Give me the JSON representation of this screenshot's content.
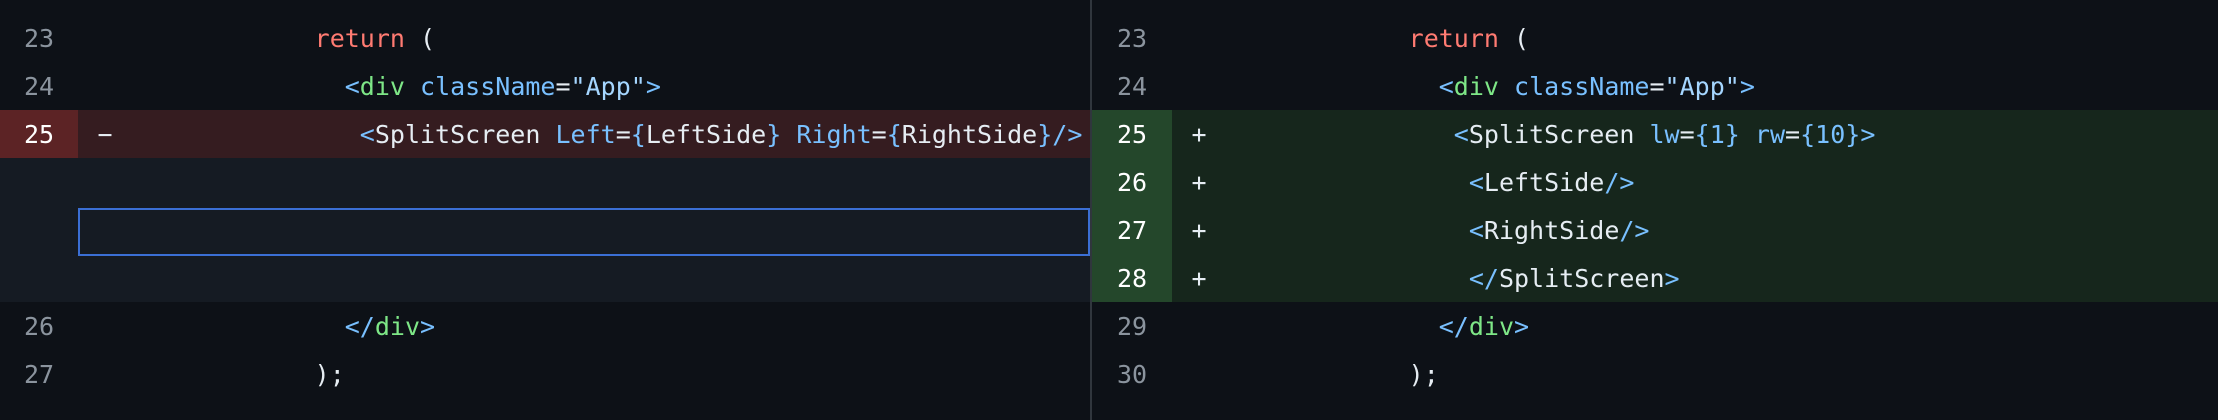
{
  "left": {
    "rows": [
      {
        "num": "23",
        "marker": "",
        "tokens": [
          {
            "t": "    ",
            "c": "txt"
          },
          {
            "t": "return",
            "c": "kw"
          },
          {
            "t": " (",
            "c": "txt"
          }
        ]
      },
      {
        "num": "24",
        "marker": "",
        "tokens": [
          {
            "t": "      ",
            "c": "txt"
          },
          {
            "t": "<",
            "c": "punct"
          },
          {
            "t": "div",
            "c": "tag"
          },
          {
            "t": " ",
            "c": "txt"
          },
          {
            "t": "className",
            "c": "attr"
          },
          {
            "t": "=",
            "c": "txt"
          },
          {
            "t": "\"App\"",
            "c": "str"
          },
          {
            "t": ">",
            "c": "punct"
          }
        ]
      },
      {
        "num": "25",
        "marker": "−",
        "tokens": [
          {
            "t": "       ",
            "c": "txt"
          },
          {
            "t": "<",
            "c": "punct"
          },
          {
            "t": "SplitScreen",
            "c": "txt"
          },
          {
            "t": " ",
            "c": "txt"
          },
          {
            "t": "Left",
            "c": "attr"
          },
          {
            "t": "=",
            "c": "txt"
          },
          {
            "t": "{",
            "c": "punct"
          },
          {
            "t": "LeftSide",
            "c": "txt"
          },
          {
            "t": "}",
            "c": "punct"
          },
          {
            "t": " ",
            "c": "txt"
          },
          {
            "t": "Right",
            "c": "attr"
          },
          {
            "t": "=",
            "c": "txt"
          },
          {
            "t": "{",
            "c": "punct"
          },
          {
            "t": "RightSide",
            "c": "txt"
          },
          {
            "t": "}",
            "c": "punct"
          },
          {
            "t": "/>",
            "c": "punct"
          }
        ]
      },
      {
        "num": "",
        "marker": "",
        "tokens": []
      },
      {
        "num": "",
        "marker": "",
        "tokens": []
      },
      {
        "num": "",
        "marker": "",
        "tokens": []
      },
      {
        "num": "26",
        "marker": "",
        "tokens": [
          {
            "t": "      ",
            "c": "txt"
          },
          {
            "t": "</",
            "c": "punct"
          },
          {
            "t": "div",
            "c": "tag"
          },
          {
            "t": ">",
            "c": "punct"
          }
        ]
      },
      {
        "num": "27",
        "marker": "",
        "tokens": [
          {
            "t": "    ",
            "c": "txt"
          },
          {
            "t": ");",
            "c": "txt"
          }
        ]
      }
    ]
  },
  "right": {
    "rows": [
      {
        "num": "23",
        "marker": "",
        "tokens": [
          {
            "t": "    ",
            "c": "txt"
          },
          {
            "t": "return",
            "c": "kw"
          },
          {
            "t": " (",
            "c": "txt"
          }
        ]
      },
      {
        "num": "24",
        "marker": "",
        "tokens": [
          {
            "t": "      ",
            "c": "txt"
          },
          {
            "t": "<",
            "c": "punct"
          },
          {
            "t": "div",
            "c": "tag"
          },
          {
            "t": " ",
            "c": "txt"
          },
          {
            "t": "className",
            "c": "attr"
          },
          {
            "t": "=",
            "c": "txt"
          },
          {
            "t": "\"App\"",
            "c": "str"
          },
          {
            "t": ">",
            "c": "punct"
          }
        ]
      },
      {
        "num": "25",
        "marker": "+",
        "tokens": [
          {
            "t": "       ",
            "c": "txt"
          },
          {
            "t": "<",
            "c": "punct"
          },
          {
            "t": "SplitScreen",
            "c": "txt"
          },
          {
            "t": " ",
            "c": "txt"
          },
          {
            "t": "lw",
            "c": "attr"
          },
          {
            "t": "=",
            "c": "txt"
          },
          {
            "t": "{",
            "c": "punct"
          },
          {
            "t": "1",
            "c": "num"
          },
          {
            "t": "}",
            "c": "punct"
          },
          {
            "t": " ",
            "c": "txt"
          },
          {
            "t": "rw",
            "c": "attr"
          },
          {
            "t": "=",
            "c": "txt"
          },
          {
            "t": "{",
            "c": "punct"
          },
          {
            "t": "10",
            "c": "num"
          },
          {
            "t": "}",
            "c": "punct"
          },
          {
            "t": ">",
            "c": "punct"
          }
        ]
      },
      {
        "num": "26",
        "marker": "+",
        "tokens": [
          {
            "t": "        ",
            "c": "txt"
          },
          {
            "t": "<",
            "c": "punct"
          },
          {
            "t": "LeftSide",
            "c": "txt"
          },
          {
            "t": "/>",
            "c": "punct"
          }
        ]
      },
      {
        "num": "27",
        "marker": "+",
        "tokens": [
          {
            "t": "        ",
            "c": "txt"
          },
          {
            "t": "<",
            "c": "punct"
          },
          {
            "t": "RightSide",
            "c": "txt"
          },
          {
            "t": "/>",
            "c": "punct"
          }
        ]
      },
      {
        "num": "28",
        "marker": "+",
        "tokens": [
          {
            "t": "        ",
            "c": "txt"
          },
          {
            "t": "</",
            "c": "punct"
          },
          {
            "t": "SplitScreen",
            "c": "txt"
          },
          {
            "t": ">",
            "c": "punct"
          }
        ]
      },
      {
        "num": "29",
        "marker": "",
        "tokens": [
          {
            "t": "      ",
            "c": "txt"
          },
          {
            "t": "</",
            "c": "punct"
          },
          {
            "t": "div",
            "c": "tag"
          },
          {
            "t": ">",
            "c": "punct"
          }
        ]
      },
      {
        "num": "30",
        "marker": "",
        "tokens": [
          {
            "t": "    ",
            "c": "txt"
          },
          {
            "t": ");",
            "c": "txt"
          }
        ]
      }
    ]
  },
  "colors": {
    "background": "#0d1117",
    "deleted_row": "#351c20",
    "deleted_gutter": "#5c2325",
    "added_row": "#16261c",
    "added_gutter": "#24472b",
    "empty_row": "#151b23",
    "focus_outline": "#3b6fd4"
  }
}
